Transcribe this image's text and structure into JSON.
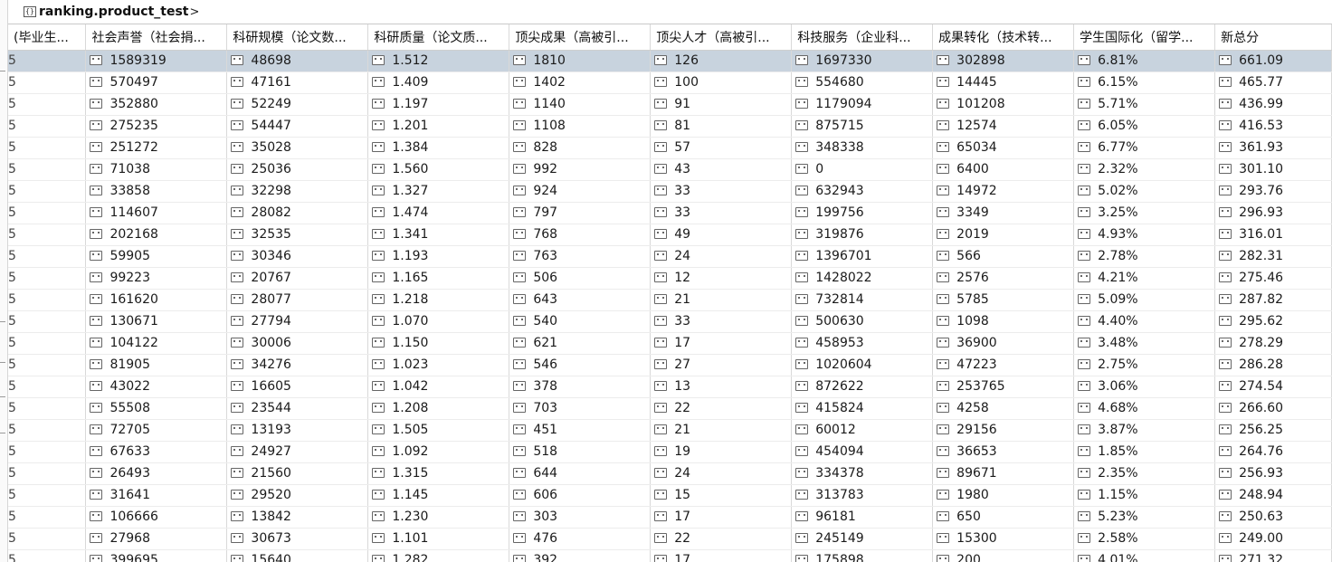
{
  "title": {
    "icon": "{}",
    "text": "ranking.product_test",
    "caret": ">"
  },
  "columns": [
    "(毕业生...",
    "社会声誉（社会捐...",
    "科研规模（论文数...",
    "科研质量（论文质...",
    "顶尖成果（高被引...",
    "顶尖人才（高被引...",
    "科技服务（企业科...",
    "成果转化（技术转...",
    "学生国际化（留学...",
    "新总分"
  ],
  "rows": [
    [
      "5",
      "1589319",
      "48698",
      "1.512",
      "1810",
      "126",
      "1697330",
      "302898",
      "6.81%",
      "661.09"
    ],
    [
      "5",
      "570497",
      "47161",
      "1.409",
      "1402",
      "100",
      "554680",
      "14445",
      "6.15%",
      "465.77"
    ],
    [
      "5",
      "352880",
      "52249",
      "1.197",
      "1140",
      "91",
      "1179094",
      "101208",
      "5.71%",
      "436.99"
    ],
    [
      "5",
      "275235",
      "54447",
      "1.201",
      "1108",
      "81",
      "875715",
      "12574",
      "6.05%",
      "416.53"
    ],
    [
      "5",
      "251272",
      "35028",
      "1.384",
      "828",
      "57",
      "348338",
      "65034",
      "6.77%",
      "361.93"
    ],
    [
      "5",
      "71038",
      "25036",
      "1.560",
      "992",
      "43",
      "0",
      "6400",
      "2.32%",
      "301.10"
    ],
    [
      "5",
      "33858",
      "32298",
      "1.327",
      "924",
      "33",
      "632943",
      "14972",
      "5.02%",
      "293.76"
    ],
    [
      "5",
      "114607",
      "28082",
      "1.474",
      "797",
      "33",
      "199756",
      "3349",
      "3.25%",
      "296.93"
    ],
    [
      "5",
      "202168",
      "32535",
      "1.341",
      "768",
      "49",
      "319876",
      "2019",
      "4.93%",
      "316.01"
    ],
    [
      "5",
      "59905",
      "30346",
      "1.193",
      "763",
      "24",
      "1396701",
      "566",
      "2.78%",
      "282.31"
    ],
    [
      "5",
      "99223",
      "20767",
      "1.165",
      "506",
      "12",
      "1428022",
      "2576",
      "4.21%",
      "275.46"
    ],
    [
      "5",
      "161620",
      "28077",
      "1.218",
      "643",
      "21",
      "732814",
      "5785",
      "5.09%",
      "287.82"
    ],
    [
      "5",
      "130671",
      "27794",
      "1.070",
      "540",
      "33",
      "500630",
      "1098",
      "4.40%",
      "295.62"
    ],
    [
      "5",
      "104122",
      "30006",
      "1.150",
      "621",
      "17",
      "458953",
      "36900",
      "3.48%",
      "278.29"
    ],
    [
      "5",
      "81905",
      "34276",
      "1.023",
      "546",
      "27",
      "1020604",
      "47223",
      "2.75%",
      "286.28"
    ],
    [
      "5",
      "43022",
      "16605",
      "1.042",
      "378",
      "13",
      "872622",
      "253765",
      "3.06%",
      "274.54"
    ],
    [
      "5",
      "55508",
      "23544",
      "1.208",
      "703",
      "22",
      "415824",
      "4258",
      "4.68%",
      "266.60"
    ],
    [
      "5",
      "72705",
      "13193",
      "1.505",
      "451",
      "21",
      "60012",
      "29156",
      "3.87%",
      "256.25"
    ],
    [
      "5",
      "67633",
      "24927",
      "1.092",
      "518",
      "19",
      "454094",
      "36653",
      "1.85%",
      "264.76"
    ],
    [
      "5",
      "26493",
      "21560",
      "1.315",
      "644",
      "24",
      "334378",
      "89671",
      "2.35%",
      "256.93"
    ],
    [
      "5",
      "31641",
      "29520",
      "1.145",
      "606",
      "15",
      "313783",
      "1980",
      "1.15%",
      "248.94"
    ],
    [
      "5",
      "106666",
      "13842",
      "1.230",
      "303",
      "17",
      "96181",
      "650",
      "5.23%",
      "250.63"
    ],
    [
      "5",
      "27968",
      "30673",
      "1.101",
      "476",
      "22",
      "245149",
      "15300",
      "2.58%",
      "249.00"
    ],
    [
      "5",
      "399695",
      "15640",
      "1.282",
      "392",
      "17",
      "175898",
      "200",
      "4.01%",
      "271.32"
    ]
  ],
  "selected_row": 0,
  "colors": {
    "selected_row": "#c8d3de",
    "grid_line": "#d9d9d9"
  },
  "icons": {
    "cell": "null-value-icon",
    "title": "table-braces-icon"
  }
}
